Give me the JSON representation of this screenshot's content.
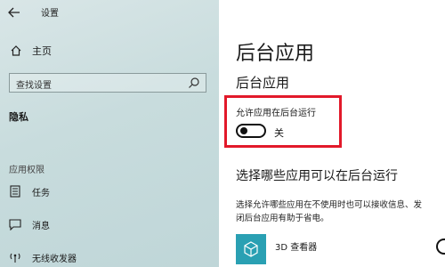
{
  "window": {
    "title": "设置"
  },
  "sidebar": {
    "home_label": "主页",
    "search_placeholder": "查找设置",
    "section": "隐私",
    "group_title": "应用权限",
    "items": [
      {
        "label": "任务",
        "icon": "tasks-icon"
      },
      {
        "label": "消息",
        "icon": "message-icon"
      },
      {
        "label": "无线收发器",
        "icon": "radio-icon"
      }
    ]
  },
  "main": {
    "page_title": "后台应用",
    "sub_title": "后台应用",
    "allow_label": "允许应用在后台运行",
    "toggle_state": "关",
    "toggle_on": false,
    "choose_title": "选择哪些应用可以在后台运行",
    "description_lines": [
      "选择允许哪些应用在不使用时也可以接收信息、发",
      "闭后台应用有助于省电。"
    ],
    "apps": [
      {
        "name": "3D 查看器",
        "icon": "cube-icon"
      }
    ]
  },
  "colors": {
    "accent_highlight": "#e2192a",
    "app_tile": "#2aa0b3"
  }
}
